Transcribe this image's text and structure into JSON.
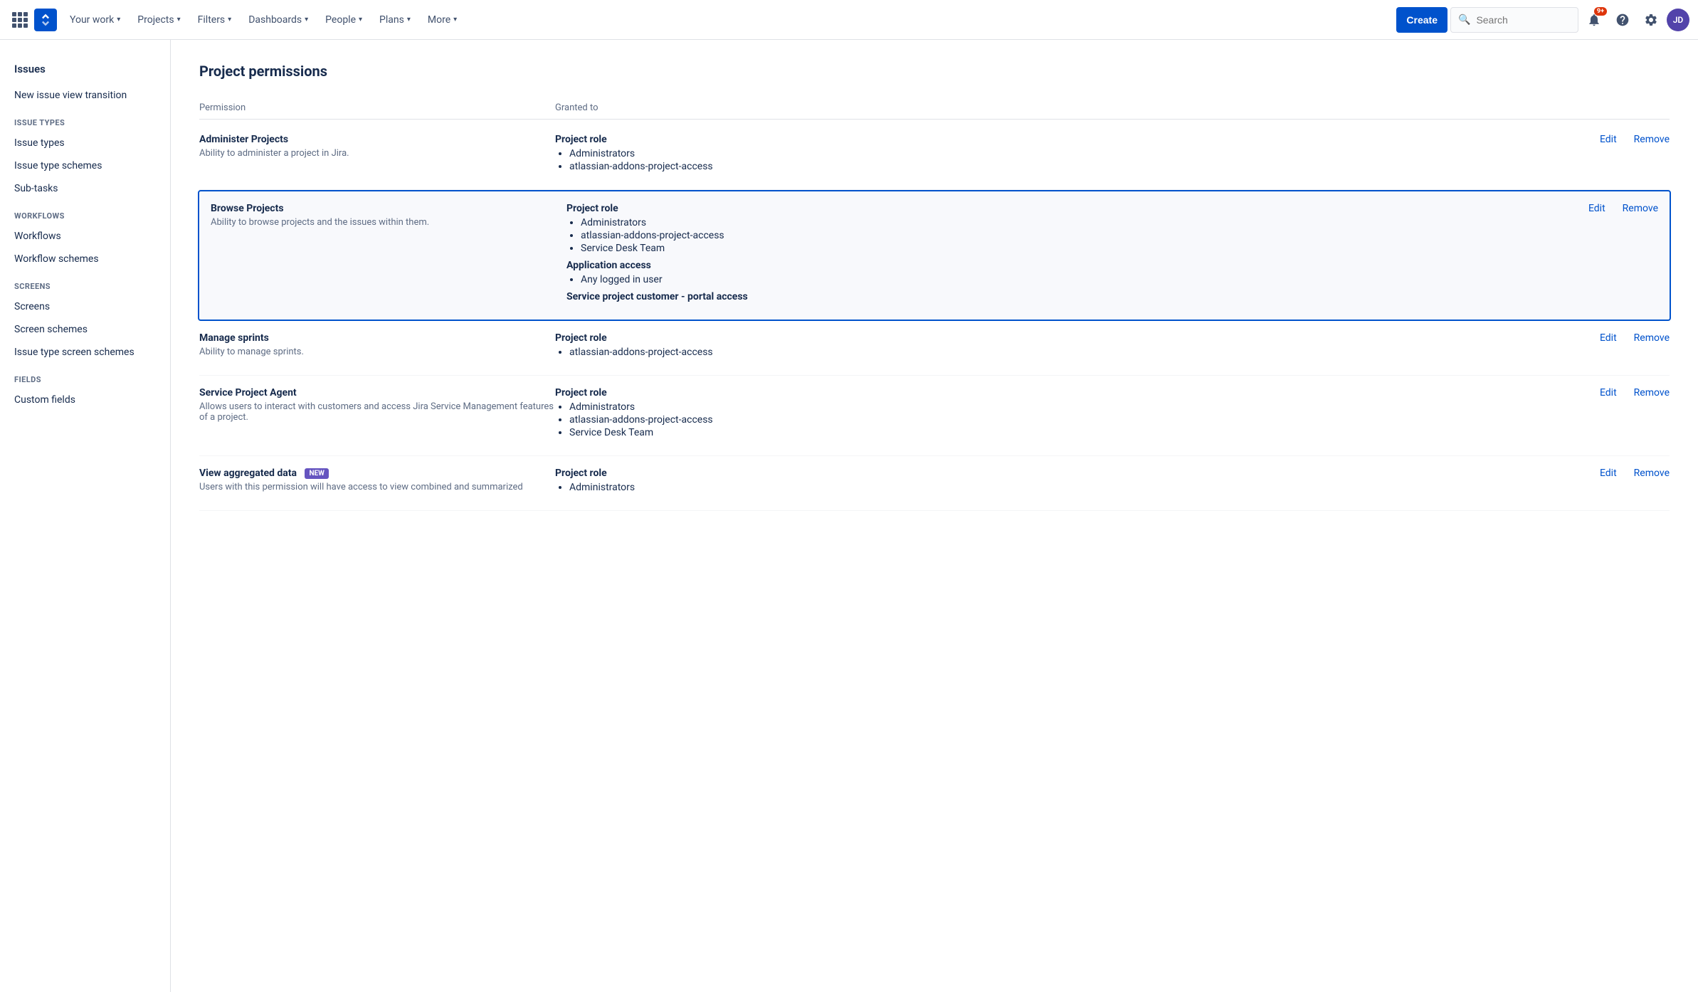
{
  "topnav": {
    "logo_alt": "Jira",
    "items": [
      {
        "label": "Your work",
        "id": "your-work"
      },
      {
        "label": "Projects",
        "id": "projects"
      },
      {
        "label": "Filters",
        "id": "filters"
      },
      {
        "label": "Dashboards",
        "id": "dashboards"
      },
      {
        "label": "People",
        "id": "people"
      },
      {
        "label": "Plans",
        "id": "plans"
      },
      {
        "label": "More",
        "id": "more"
      }
    ],
    "create_label": "Create",
    "search_placeholder": "Search",
    "notification_count": "9+",
    "avatar_initials": "JD"
  },
  "sidebar": {
    "top_section_label": "Issues",
    "top_item_label": "Issues",
    "items": [
      {
        "label": "New issue view transition",
        "id": "new-issue-view-transition",
        "section": "top"
      },
      {
        "label": "ISSUE TYPES",
        "id": "issue-types-header",
        "type": "section-label"
      },
      {
        "label": "Issue types",
        "id": "issue-types"
      },
      {
        "label": "Issue type schemes",
        "id": "issue-type-schemes"
      },
      {
        "label": "Sub-tasks",
        "id": "sub-tasks"
      },
      {
        "label": "WORKFLOWS",
        "id": "workflows-header",
        "type": "section-label"
      },
      {
        "label": "Workflows",
        "id": "workflows"
      },
      {
        "label": "Workflow schemes",
        "id": "workflow-schemes"
      },
      {
        "label": "SCREENS",
        "id": "screens-header",
        "type": "section-label"
      },
      {
        "label": "Screens",
        "id": "screens"
      },
      {
        "label": "Screen schemes",
        "id": "screen-schemes"
      },
      {
        "label": "Issue type screen schemes",
        "id": "issue-type-screen-schemes"
      },
      {
        "label": "FIELDS",
        "id": "fields-header",
        "type": "section-label"
      },
      {
        "label": "Custom fields",
        "id": "custom-fields"
      }
    ]
  },
  "main": {
    "title": "Project permissions",
    "columns": {
      "permission": "Permission",
      "granted_to": "Granted to"
    },
    "permissions": [
      {
        "id": "administer-projects",
        "name": "Administer Projects",
        "description": "Ability to administer a project in Jira.",
        "highlighted": false,
        "granted_groups": [
          {
            "title": "Project role",
            "items": [
              "Administrators",
              "atlassian-addons-project-access"
            ]
          }
        ],
        "edit_label": "Edit",
        "remove_label": "Remove"
      },
      {
        "id": "browse-projects",
        "name": "Browse Projects",
        "description": "Ability to browse projects and the issues within them.",
        "highlighted": true,
        "granted_groups": [
          {
            "title": "Project role",
            "items": [
              "Administrators",
              "atlassian-addons-project-access",
              "Service Desk Team"
            ]
          },
          {
            "title": "Application access",
            "items": [
              "Any logged in user"
            ]
          },
          {
            "title": "Service project customer - portal access",
            "items": []
          }
        ],
        "edit_label": "Edit",
        "remove_label": "Remove"
      },
      {
        "id": "manage-sprints",
        "name": "Manage sprints",
        "description": "Ability to manage sprints.",
        "highlighted": false,
        "granted_groups": [
          {
            "title": "Project role",
            "items": [
              "atlassian-addons-project-access"
            ]
          }
        ],
        "edit_label": "Edit",
        "remove_label": "Remove"
      },
      {
        "id": "service-project-agent",
        "name": "Service Project Agent",
        "description": "Allows users to interact with customers and access Jira Service Management features of a project.",
        "highlighted": false,
        "granted_groups": [
          {
            "title": "Project role",
            "items": [
              "Administrators",
              "atlassian-addons-project-access",
              "Service Desk Team"
            ]
          }
        ],
        "edit_label": "Edit",
        "remove_label": "Remove"
      },
      {
        "id": "view-aggregated-data",
        "name": "View aggregated data",
        "badge": "NEW",
        "description": "Users with this permission will have access to view combined and summarized",
        "highlighted": false,
        "granted_groups": [
          {
            "title": "Project role",
            "items": [
              "Administrators"
            ]
          }
        ],
        "edit_label": "Edit",
        "remove_label": "Remove"
      }
    ]
  }
}
